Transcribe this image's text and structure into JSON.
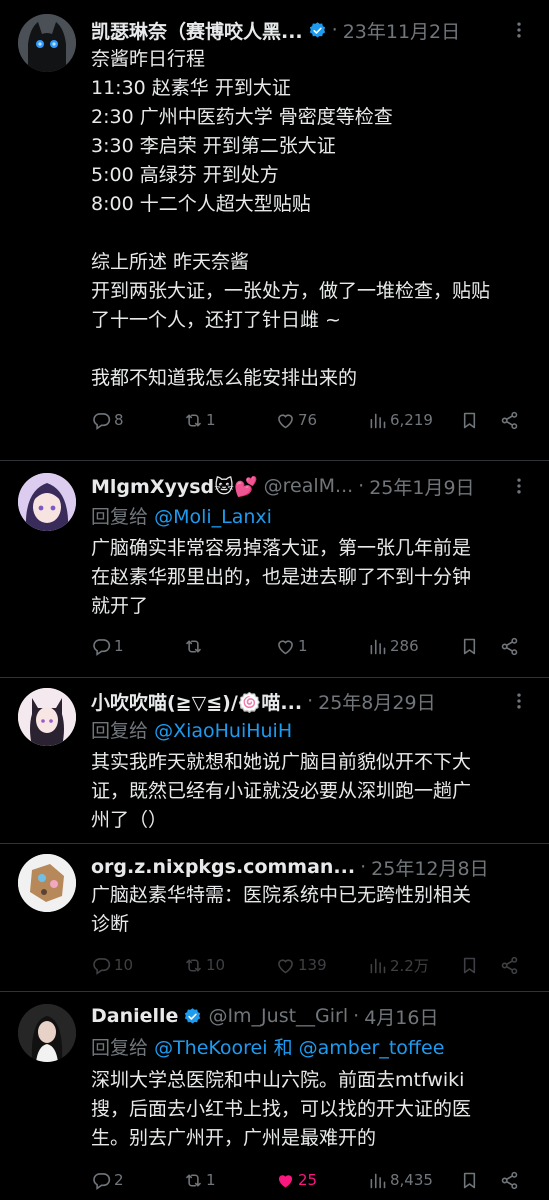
{
  "tweets": [
    {
      "name": "凯瑟琳奈（赛博咬人黑...",
      "handle": "",
      "dot": "·",
      "date": "23年11月2日",
      "verified": true,
      "lines": [
        "奈酱昨日行程",
        "11:30 赵素华 开到大证",
        "2:30 广州中医药大学 骨密度等检查",
        "3:30 李启荣 开到第二张大证",
        "5:00 高绿芬 开到处方",
        "8:00 十二个人超大型贴贴",
        "",
        "综上所述 昨天奈酱",
        "开到两张大证，一张处方，做了一堆检查，贴贴",
        "了十一个人，还打了针日雌 ~",
        "",
        "我都不知道我怎么能安排出来的"
      ],
      "replies": "8",
      "reposts": "1",
      "likes": "76",
      "views": "6,219"
    },
    {
      "name": "MlgmXyysd🐱💕",
      "handle": "@realM...",
      "dot": "·",
      "date": "25年1月9日",
      "reply_prefix": "回复给",
      "reply_to": "@Moli_Lanxi",
      "lines": [
        "广脑确实非常容易掉落大证，第一张几年前是",
        "在赵素华那里出的，也是进去聊了不到十分钟",
        "就开了"
      ],
      "replies": "1",
      "reposts": "",
      "likes": "1",
      "views": "286"
    },
    {
      "name": "小吹吹喵(≧▽≦)/🍥喵...",
      "dot": "·",
      "date": "25年8月29日",
      "reply_prefix": "回复给",
      "reply_to": "@XiaoHuiHuiH",
      "lines": [
        "其实我昨天就想和她说广脑目前貌似开不下大",
        "证，既然已经有小证就没必要从深圳跑一趟广",
        "州了（）"
      ]
    },
    {
      "name": "org.z.nixpkgs.comman...",
      "dot": "·",
      "date": "25年12月8日",
      "lines": [
        "广脑赵素华特需：医院系统中已无跨性别相关",
        "诊断"
      ],
      "replies": "10",
      "reposts": "10",
      "likes": "139",
      "views": "2.2万"
    },
    {
      "name": "Danielle",
      "handle": "@Im_Just__Girl",
      "dot": "·",
      "date": "4月16日",
      "verified": true,
      "reply_prefix": "回复给",
      "reply_to": "@TheKoorei",
      "reply_and": "和",
      "reply_to2": "@amber_toffee",
      "lines": [
        "深圳大学总医院和中山六院。前面去mtfwiki",
        "搜，后面去小红书上找，可以找的开大证的医",
        "生。别去广州开，广州是最难开的"
      ],
      "replies": "2",
      "reposts": "1",
      "likes": "25",
      "views": "8,435"
    }
  ],
  "colors": {
    "accent": "#1d9bf0",
    "like": "#f91880",
    "muted": "#71767b",
    "text": "#e7e9ea"
  }
}
